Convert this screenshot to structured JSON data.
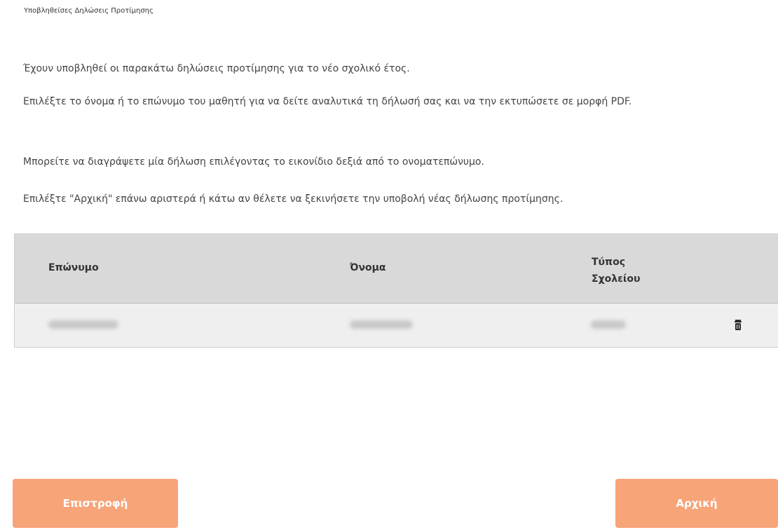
{
  "breadcrumb": "Υποβληθείσες Δηλώσεις Προτίμησης",
  "paragraphs": {
    "p1": "Έχουν υποβληθεί οι παρακάτω δηλώσεις προτίμησης για το νέο σχολικό έτος.",
    "p2": "Επιλέξτε το όνομα ή το επώνυμο του μαθητή για να δείτε αναλυτικά τη δήλωσή σας και να την εκτυπώσετε σε μορφή PDF.",
    "p3": "Μπορείτε να διαγράψετε μία δήλωση επιλέγοντας το εικονίδιο δεξιά από το ονοματεπώνυμο.",
    "p4": "Επιλέξτε \"Αρχική\" επάνω αριστερά ή κάτω αν θέλετε να ξεκινήσετε την υποβολή νέας δήλωσης προτίμησης."
  },
  "table": {
    "headers": {
      "surname": "Επώνυμο",
      "name": "Όνομα",
      "school_type": "Τύπος Σχολείου"
    },
    "rows": [
      {
        "surname": "",
        "name": "",
        "school_type": "",
        "delete_icon": "trash-icon"
      }
    ]
  },
  "buttons": {
    "back": "Επιστροφή",
    "home": "Αρχική"
  },
  "colors": {
    "button_bg": "#f7a479",
    "header_bg": "#d9d9d9",
    "row_bg": "#efefef"
  }
}
